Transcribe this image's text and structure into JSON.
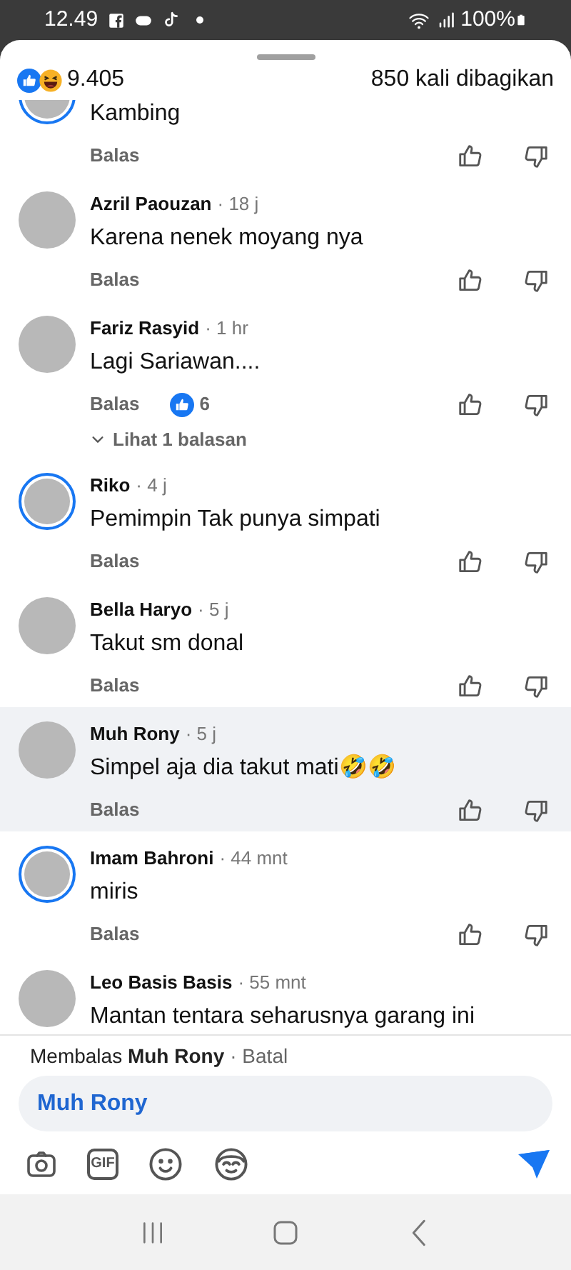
{
  "status_bar": {
    "time": "12.49",
    "battery": "100%"
  },
  "header": {
    "reactions_count": "9.405",
    "shares": "850 kali dibagikan"
  },
  "comments": [
    {
      "text": "Kambing",
      "reply_label": "Balas",
      "story_ring": true,
      "highlighted": false
    },
    {
      "name": "Azril Paouzan",
      "time": "· 18 j",
      "text": "Karena nenek moyang nya",
      "reply_label": "Balas",
      "story_ring": false,
      "highlighted": false
    },
    {
      "name": "Fariz Rasyid",
      "time": "· 1 hr",
      "text": "Lagi Sariawan....",
      "reply_label": "Balas",
      "story_ring": false,
      "highlighted": false,
      "likes": "6",
      "replies": "Lihat 1 balasan"
    },
    {
      "name": "Riko",
      "time": "· 4 j",
      "text": "Pemimpin Tak punya simpati",
      "reply_label": "Balas",
      "story_ring": true,
      "highlighted": false
    },
    {
      "name": "Bella Haryo",
      "time": "· 5 j",
      "text": "Takut sm donal",
      "reply_label": "Balas",
      "story_ring": false,
      "highlighted": false
    },
    {
      "name": "Muh Rony",
      "time": "· 5 j",
      "text": "Simpel aja dia takut mati🤣🤣",
      "reply_label": "Balas",
      "story_ring": false,
      "highlighted": true
    },
    {
      "name": "Imam Bahroni",
      "time": "· 44 mnt",
      "text": "miris",
      "reply_label": "Balas",
      "story_ring": true,
      "highlighted": false
    },
    {
      "name": "Leo Basis Basis",
      "time": "· 55 mnt",
      "text": "Mantan tentara seharusnya garang ini",
      "story_ring": false,
      "highlighted": false
    }
  ],
  "reply_bar": {
    "prefix": "Membalas",
    "target": "Muh Rony",
    "cancel": "· Batal",
    "input_value": "Muh Rony",
    "gif_label": "GIF"
  }
}
